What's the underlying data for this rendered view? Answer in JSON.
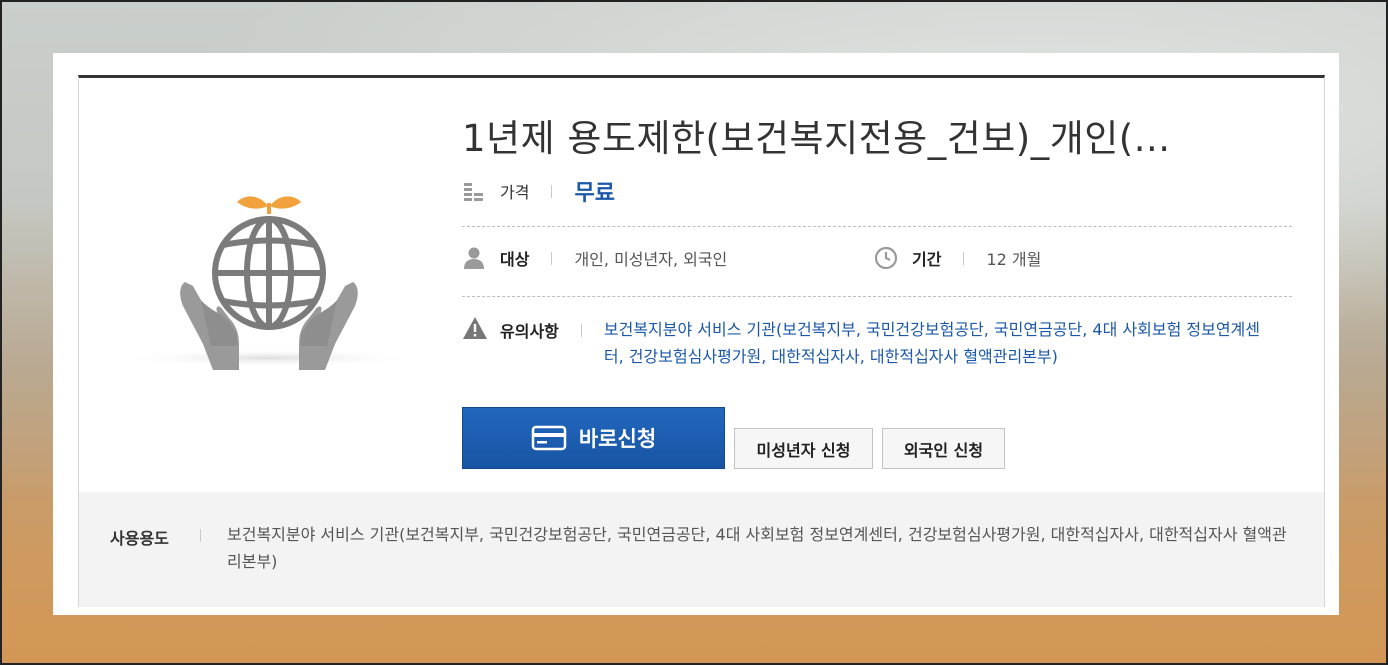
{
  "product": {
    "title": "1년제 용도제한(보건복지전용_건보)_개인(...",
    "image_icon": "globe-in-hands-icon"
  },
  "price": {
    "label": "가격",
    "value": "무료",
    "icon": "coins-icon"
  },
  "target": {
    "label": "대상",
    "value": "개인, 미성년자, 외국인",
    "icon": "person-icon"
  },
  "period": {
    "label": "기간",
    "value": "12 개월",
    "icon": "clock-icon"
  },
  "notice": {
    "label": "유의사항",
    "value": "보건복지분야 서비스 기관(보건복지부, 국민건강보험공단, 국민연금공단, 4대 사회보험 정보연계센터, 건강보험심사평가원, 대한적십자사, 대한적십자사 혈액관리본부)",
    "icon": "warning-icon"
  },
  "buttons": {
    "apply": "바로신청",
    "apply_icon": "card-icon",
    "minor": "미성년자 신청",
    "foreigner": "외국인 신청"
  },
  "usage": {
    "label": "사용용도",
    "value": "보건복지분야 서비스 기관(보건복지부, 국민건강보험공단, 국민연금공단, 4대 사회보험 정보연계센터, 건강보험심사평가원, 대한적십자사, 대한적십자사 혈액관리본부)"
  },
  "colors": {
    "accent": "#1d58a8",
    "button": "#1f5fb1",
    "icon_gray": "#808080",
    "sprout": "#f0a03a"
  }
}
